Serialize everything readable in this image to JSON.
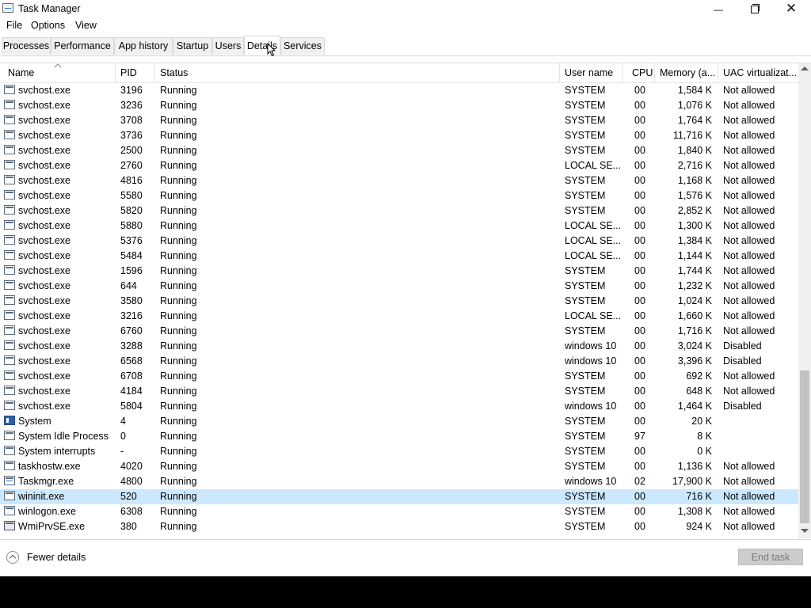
{
  "window": {
    "title": "Task Manager",
    "minimize_glyph": "—",
    "maximize_glyph": "",
    "close_glyph": "✕"
  },
  "menu": {
    "file": "File",
    "options": "Options",
    "view": "View"
  },
  "tabs": [
    {
      "label": "Processes"
    },
    {
      "label": "Performance"
    },
    {
      "label": "App history"
    },
    {
      "label": "Startup"
    },
    {
      "label": "Users"
    },
    {
      "label": "Details",
      "active": true
    },
    {
      "label": "Services"
    }
  ],
  "columns": {
    "name": "Name",
    "pid": "PID",
    "status": "Status",
    "user": "User name",
    "cpu": "CPU",
    "memory": "Memory (a...",
    "uac": "UAC virtualizat..."
  },
  "rows": [
    {
      "icon": "generic",
      "name": "svchost.exe",
      "pid": "3196",
      "status": "Running",
      "user": "SYSTEM",
      "cpu": "00",
      "memory": "1,584 K",
      "uac": "Not allowed"
    },
    {
      "icon": "generic",
      "name": "svchost.exe",
      "pid": "3236",
      "status": "Running",
      "user": "SYSTEM",
      "cpu": "00",
      "memory": "1,076 K",
      "uac": "Not allowed"
    },
    {
      "icon": "generic",
      "name": "svchost.exe",
      "pid": "3708",
      "status": "Running",
      "user": "SYSTEM",
      "cpu": "00",
      "memory": "1,764 K",
      "uac": "Not allowed"
    },
    {
      "icon": "generic",
      "name": "svchost.exe",
      "pid": "3736",
      "status": "Running",
      "user": "SYSTEM",
      "cpu": "00",
      "memory": "11,716 K",
      "uac": "Not allowed"
    },
    {
      "icon": "generic",
      "name": "svchost.exe",
      "pid": "2500",
      "status": "Running",
      "user": "SYSTEM",
      "cpu": "00",
      "memory": "1,840 K",
      "uac": "Not allowed"
    },
    {
      "icon": "generic",
      "name": "svchost.exe",
      "pid": "2760",
      "status": "Running",
      "user": "LOCAL SE...",
      "cpu": "00",
      "memory": "2,716 K",
      "uac": "Not allowed"
    },
    {
      "icon": "generic",
      "name": "svchost.exe",
      "pid": "4816",
      "status": "Running",
      "user": "SYSTEM",
      "cpu": "00",
      "memory": "1,168 K",
      "uac": "Not allowed"
    },
    {
      "icon": "generic",
      "name": "svchost.exe",
      "pid": "5580",
      "status": "Running",
      "user": "SYSTEM",
      "cpu": "00",
      "memory": "1,576 K",
      "uac": "Not allowed"
    },
    {
      "icon": "generic",
      "name": "svchost.exe",
      "pid": "5820",
      "status": "Running",
      "user": "SYSTEM",
      "cpu": "00",
      "memory": "2,852 K",
      "uac": "Not allowed"
    },
    {
      "icon": "generic",
      "name": "svchost.exe",
      "pid": "5880",
      "status": "Running",
      "user": "LOCAL SE...",
      "cpu": "00",
      "memory": "1,300 K",
      "uac": "Not allowed"
    },
    {
      "icon": "generic",
      "name": "svchost.exe",
      "pid": "5376",
      "status": "Running",
      "user": "LOCAL SE...",
      "cpu": "00",
      "memory": "1,384 K",
      "uac": "Not allowed"
    },
    {
      "icon": "generic",
      "name": "svchost.exe",
      "pid": "5484",
      "status": "Running",
      "user": "LOCAL SE...",
      "cpu": "00",
      "memory": "1,144 K",
      "uac": "Not allowed"
    },
    {
      "icon": "generic",
      "name": "svchost.exe",
      "pid": "1596",
      "status": "Running",
      "user": "SYSTEM",
      "cpu": "00",
      "memory": "1,744 K",
      "uac": "Not allowed"
    },
    {
      "icon": "generic",
      "name": "svchost.exe",
      "pid": "644",
      "status": "Running",
      "user": "SYSTEM",
      "cpu": "00",
      "memory": "1,232 K",
      "uac": "Not allowed"
    },
    {
      "icon": "generic",
      "name": "svchost.exe",
      "pid": "3580",
      "status": "Running",
      "user": "SYSTEM",
      "cpu": "00",
      "memory": "1,024 K",
      "uac": "Not allowed"
    },
    {
      "icon": "generic",
      "name": "svchost.exe",
      "pid": "3216",
      "status": "Running",
      "user": "LOCAL SE...",
      "cpu": "00",
      "memory": "1,660 K",
      "uac": "Not allowed"
    },
    {
      "icon": "generic",
      "name": "svchost.exe",
      "pid": "6760",
      "status": "Running",
      "user": "SYSTEM",
      "cpu": "00",
      "memory": "1,716 K",
      "uac": "Not allowed"
    },
    {
      "icon": "generic",
      "name": "svchost.exe",
      "pid": "3288",
      "status": "Running",
      "user": "windows 10",
      "cpu": "00",
      "memory": "3,024 K",
      "uac": "Disabled"
    },
    {
      "icon": "generic",
      "name": "svchost.exe",
      "pid": "6568",
      "status": "Running",
      "user": "windows 10",
      "cpu": "00",
      "memory": "3,396 K",
      "uac": "Disabled"
    },
    {
      "icon": "generic",
      "name": "svchost.exe",
      "pid": "6708",
      "status": "Running",
      "user": "SYSTEM",
      "cpu": "00",
      "memory": "692 K",
      "uac": "Not allowed"
    },
    {
      "icon": "generic",
      "name": "svchost.exe",
      "pid": "4184",
      "status": "Running",
      "user": "SYSTEM",
      "cpu": "00",
      "memory": "648 K",
      "uac": "Not allowed"
    },
    {
      "icon": "generic",
      "name": "svchost.exe",
      "pid": "5804",
      "status": "Running",
      "user": "windows 10",
      "cpu": "00",
      "memory": "1,464 K",
      "uac": "Disabled"
    },
    {
      "icon": "system",
      "name": "System",
      "pid": "4",
      "status": "Running",
      "user": "SYSTEM",
      "cpu": "00",
      "memory": "20 K",
      "uac": ""
    },
    {
      "icon": "generic",
      "name": "System Idle Process",
      "pid": "0",
      "status": "Running",
      "user": "SYSTEM",
      "cpu": "97",
      "memory": "8 K",
      "uac": ""
    },
    {
      "icon": "generic",
      "name": "System interrupts",
      "pid": "-",
      "status": "Running",
      "user": "SYSTEM",
      "cpu": "00",
      "memory": "0 K",
      "uac": ""
    },
    {
      "icon": "generic",
      "name": "taskhostw.exe",
      "pid": "4020",
      "status": "Running",
      "user": "SYSTEM",
      "cpu": "00",
      "memory": "1,136 K",
      "uac": "Not allowed"
    },
    {
      "icon": "taskmgr",
      "name": "Taskmgr.exe",
      "pid": "4800",
      "status": "Running",
      "user": "windows 10",
      "cpu": "02",
      "memory": "17,900 K",
      "uac": "Not allowed"
    },
    {
      "icon": "generic",
      "name": "wininit.exe",
      "pid": "520",
      "status": "Running",
      "user": "SYSTEM",
      "cpu": "00",
      "memory": "716 K",
      "uac": "Not allowed",
      "selected": true
    },
    {
      "icon": "generic",
      "name": "winlogon.exe",
      "pid": "6308",
      "status": "Running",
      "user": "SYSTEM",
      "cpu": "00",
      "memory": "1,308 K",
      "uac": "Not allowed"
    },
    {
      "icon": "wmi",
      "name": "WmiPrvSE.exe",
      "pid": "380",
      "status": "Running",
      "user": "SYSTEM",
      "cpu": "00",
      "memory": "924 K",
      "uac": "Not allowed"
    }
  ],
  "footer": {
    "fewer_details": "Fewer details",
    "end_task": "End task"
  },
  "colors": {
    "selection": "#cce8ff",
    "tab_active": "#ffffff",
    "button_disabled": "#cccccc"
  },
  "icons": {
    "collapse": "chevron-up-circle-icon",
    "sort": "sort-ascending-icon",
    "cursor": "mouse-pointer-icon"
  }
}
